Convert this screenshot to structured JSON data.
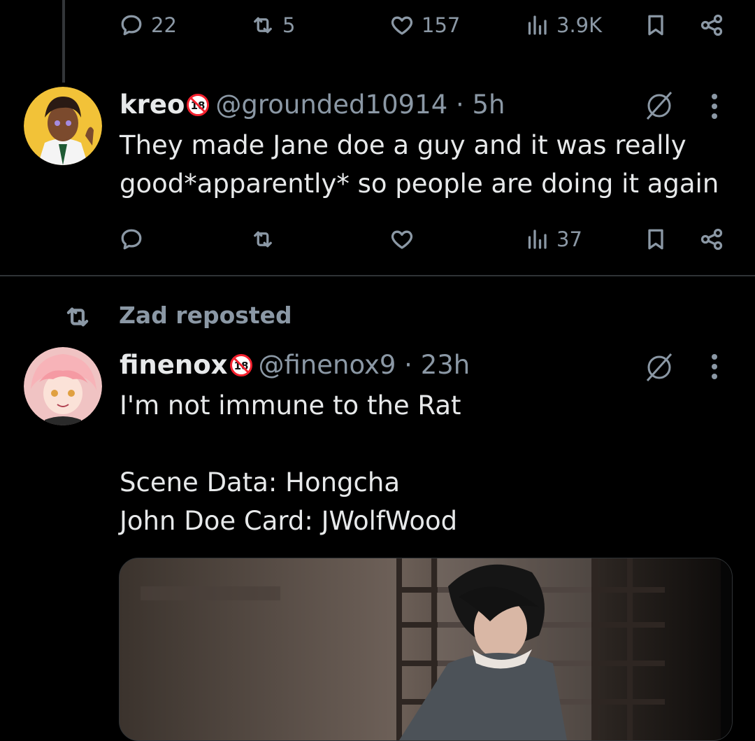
{
  "post1_actions": {
    "replies": "22",
    "reposts": "5",
    "likes": "157",
    "views": "3.9K"
  },
  "reply": {
    "display_name": "kreo",
    "handle_time": "@grounded10914 · 5h",
    "text": "They made Jane doe a guy and it was really\ngood*apparently* so people are doing it again",
    "actions": {
      "replies": "",
      "reposts": "",
      "likes": "",
      "views": "37"
    }
  },
  "repost_header": {
    "label": "Zad reposted"
  },
  "post2": {
    "display_name": "finenox",
    "handle_time": "@finenox9 · 23h",
    "text": "I'm not immune to the Rat\n\nScene Data: Hongcha\nJohn Doe Card: JWolfWood"
  },
  "colors": {
    "background": "#000000",
    "text": "#e7e9ea",
    "muted": "#8b98a5",
    "divider": "#2f3336",
    "badge_red": "#f4212e"
  },
  "icons": [
    "reply-icon",
    "repost-icon",
    "like-icon",
    "views-icon",
    "bookmark-icon",
    "share-icon",
    "no-entry-icon",
    "more-icon",
    "eighteen-plus-badge"
  ]
}
